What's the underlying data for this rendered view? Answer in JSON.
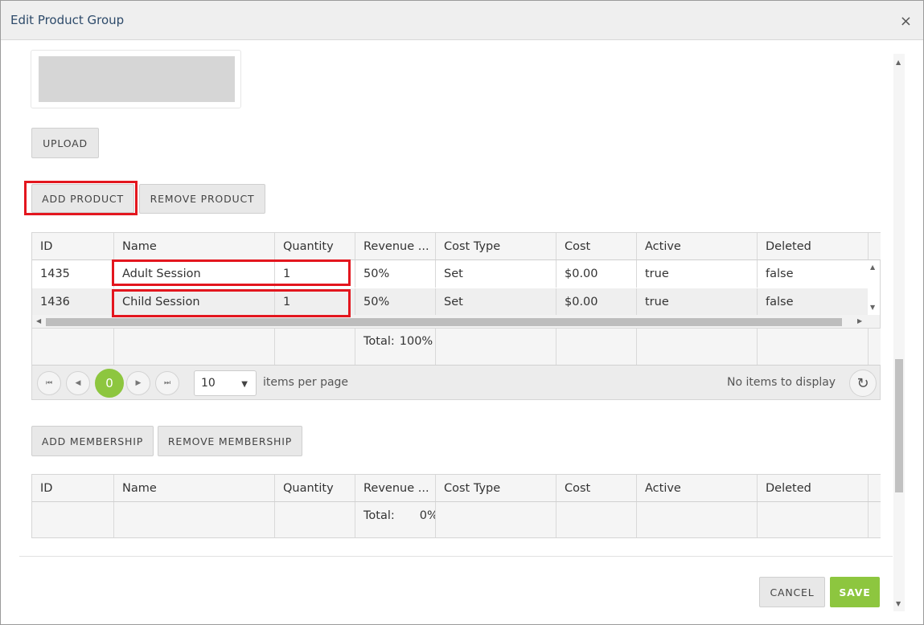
{
  "dialog": {
    "title": "Edit Product Group",
    "close": "×"
  },
  "buttons": {
    "upload": "UPLOAD",
    "add_product": "ADD PRODUCT",
    "remove_product": "REMOVE PRODUCT",
    "add_membership": "ADD MEMBERSHIP",
    "remove_membership": "REMOVE MEMBERSHIP",
    "cancel": "CANCEL",
    "save": "SAVE"
  },
  "columns": [
    "ID",
    "Name",
    "Quantity",
    "Revenue ...",
    "Cost Type",
    "Cost",
    "Active",
    "Deleted"
  ],
  "products": {
    "rows": [
      [
        "1435",
        "Adult Session",
        "1",
        "50%",
        "Set",
        "$0.00",
        "true",
        "false"
      ],
      [
        "1436",
        "Child Session",
        "1",
        "50%",
        "Set",
        "$0.00",
        "true",
        "false"
      ]
    ],
    "total_label": "Total:",
    "total_value": "100%",
    "pager": {
      "current_page": "0",
      "page_size": "10",
      "items_per_page": "items per page",
      "status": "No items to display"
    }
  },
  "memberships": {
    "total_label": "Total:",
    "total_value": "0%"
  },
  "icons": {
    "first": "⏮",
    "prev": "◀",
    "next": "▶",
    "last": "⏭",
    "refresh": "↻",
    "caret": "▼",
    "arrow_up": "▲",
    "arrow_down": "▼",
    "arrow_left": "◀",
    "arrow_right": "▶"
  },
  "colors": {
    "accent": "#8dc63f",
    "highlight": "#e3161e",
    "title": "#2d4a6a"
  }
}
